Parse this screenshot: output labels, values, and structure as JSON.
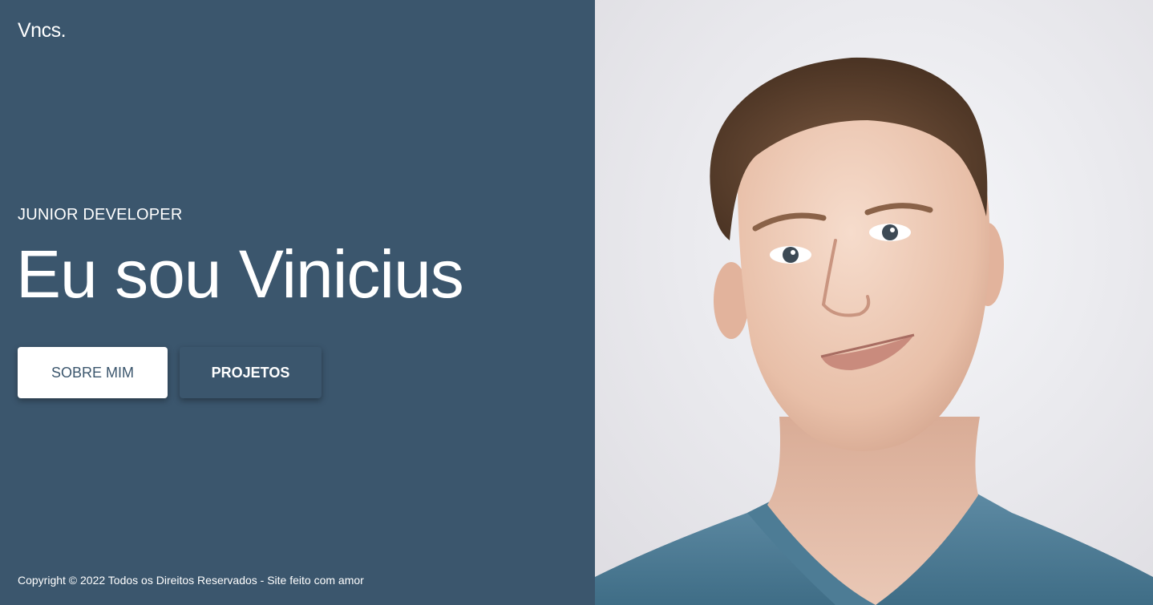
{
  "brand": {
    "logo_text": "Vncs."
  },
  "hero": {
    "subtitle": "JUNIOR DEVELOPER",
    "headline": "Eu sou Vinicius",
    "buttons": {
      "about_label": "SOBRE MIM",
      "projects_label": "PROJETOS"
    }
  },
  "footer": {
    "copyright": "Copyright © 2022 Todos os Direitos Reservados - Site feito com amor"
  },
  "colors": {
    "panel_background": "#3b566d",
    "text": "#ffffff",
    "primary_button_bg": "#ffffff",
    "primary_button_text": "#3b566d",
    "photo_background": "#eeedf1"
  },
  "portrait": {
    "description_icon": "person-portrait-photo"
  }
}
